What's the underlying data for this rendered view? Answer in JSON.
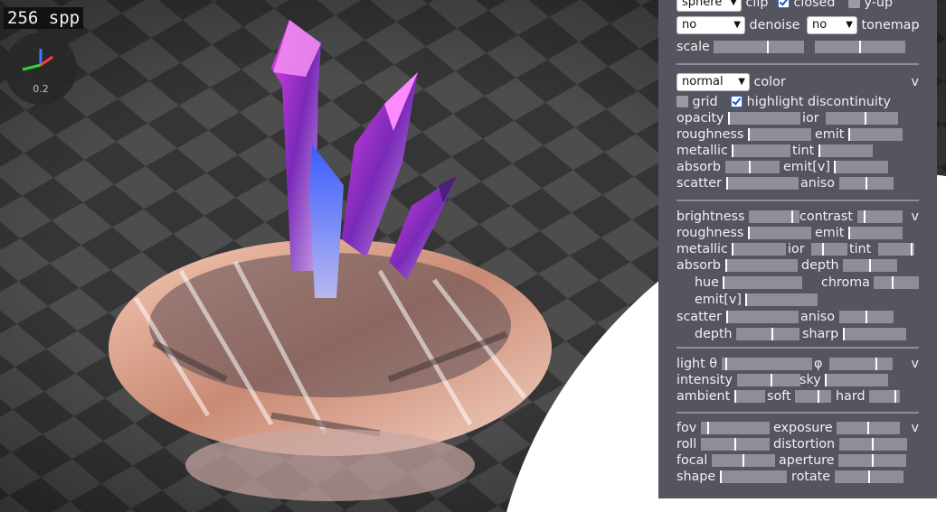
{
  "viewport": {
    "samples_label": "256 spp",
    "gizmo_zoom": "0.2",
    "colors": {
      "floor_dark": "#353535",
      "floor_light": "#505050",
      "light": "#ffffff"
    }
  },
  "panel": {
    "scene": {
      "shape_select": "sphere",
      "clip_label": "clip",
      "closed_label": "closed",
      "closed_checked": true,
      "y_up_label": "y-up",
      "y_up_checked": false,
      "denoise_select": "no",
      "denoise_label": "denoise",
      "tonemap_select": "no",
      "tonemap_label": "tonemap",
      "scale_label": "scale",
      "scale_value_1": 0.6,
      "scale_value_2": 0.5
    },
    "material": {
      "mode_select": "normal",
      "color_label": "color",
      "collapse_label": "v",
      "grid_label": "grid",
      "grid_checked": false,
      "highlight_label": "highlight discontinuity",
      "highlight_checked": true,
      "opacity_label": "opacity",
      "opacity_value": 0.0,
      "ior_label": "ior",
      "ior_value": 0.55,
      "roughness_label": "roughness",
      "roughness_value": 0.0,
      "emit_label": "emit",
      "emit_value": 0.0,
      "metallic_label": "metallic",
      "metallic_value": 0.0,
      "tint_label": "tint",
      "tint_value": 0.0,
      "absorb_label": "absorb",
      "absorb_value": 0.45,
      "emitv_label": "emit[v]",
      "emitv_value": 0.0,
      "scatter_label": "scatter",
      "scatter_value": 0.0,
      "aniso_label": "aniso",
      "aniso_value": 0.5
    },
    "adjust": {
      "brightness_label": "brightness",
      "brightness_value": 0.88,
      "contrast_label": "contrast",
      "contrast_value": 0.15,
      "collapse_label": "v",
      "roughness_label": "roughness",
      "roughness_value": 0.0,
      "emit_label": "emit",
      "emit_value": 0.0,
      "metallic_label": "metallic",
      "metallic_value": 0.0,
      "ior_label": "ior",
      "ior_value": 0.3,
      "tint_label": "tint",
      "tint_value": 0.95,
      "absorb_label": "absorb",
      "absorb_value": 0.0,
      "depth_label": "depth",
      "depth_value": 0.5,
      "hue_label": "hue",
      "hue_value": 0.0,
      "chroma_label": "chroma",
      "chroma_value": 0.4,
      "emitv_label": "emit[v]",
      "emitv_value": 0.0,
      "scatter_label": "scatter",
      "scatter_value": 0.0,
      "aniso_label": "aniso",
      "aniso_value": 0.5,
      "depth2_label": "depth",
      "depth2_value": 0.57,
      "sharp_label": "sharp",
      "sharp_value": 0.0
    },
    "light": {
      "light_label": "light θ",
      "light_value": 0.05,
      "phi_label": "φ",
      "phi_value": 0.75,
      "collapse_label": "v",
      "intensity_label": "intensity",
      "intensity_value": 0.55,
      "sky_label": "sky",
      "sky_value": 0.0,
      "ambient_label": "ambient",
      "ambient_value": 0.0,
      "soft_label": "soft",
      "soft_value": 0.65,
      "hard_label": "hard",
      "hard_value": 0.88
    },
    "camera": {
      "fov_label": "fov",
      "fov_value": 0.1,
      "exposure_label": "exposure",
      "exposure_value": 0.5,
      "collapse_label": "v",
      "roll_label": "roll",
      "roll_value": 0.5,
      "distortion_label": "distortion",
      "distortion_value": 0.5,
      "focal_label": "focal",
      "focal_value": 0.5,
      "aperture_label": "aperture",
      "aperture_value": 0.5,
      "shape_label": "shape",
      "shape_value": 0.0,
      "rotate_label": "rotate",
      "rotate_value": 0.5
    }
  }
}
